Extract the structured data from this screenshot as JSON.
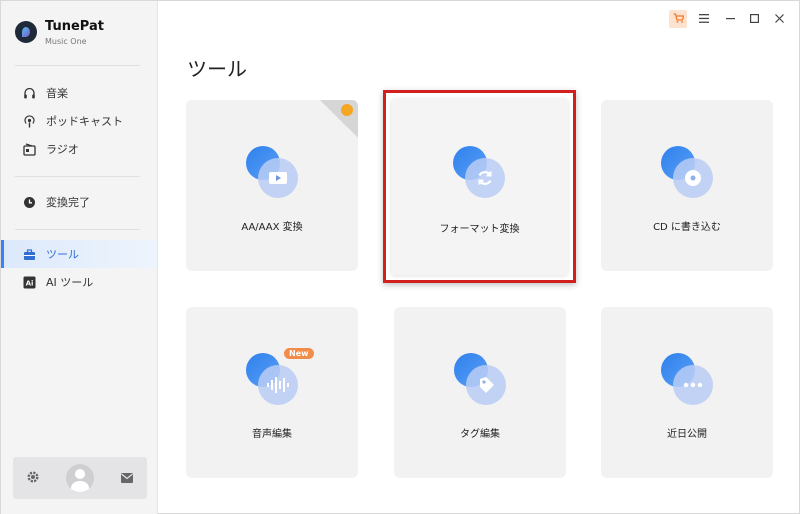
{
  "app": {
    "name": "TunePat",
    "subtitle": "Music One"
  },
  "sidebar": {
    "items": [
      {
        "label": "音楽",
        "icon": "headphones-icon"
      },
      {
        "label": "ポッドキャスト",
        "icon": "podcast-icon"
      },
      {
        "label": "ラジオ",
        "icon": "radio-icon"
      },
      {
        "label": "変換完了",
        "icon": "clock-icon"
      },
      {
        "label": "ツール",
        "icon": "toolbox-icon"
      },
      {
        "label": "AI ツール",
        "icon": "ai-icon"
      }
    ],
    "active": "ツール"
  },
  "main": {
    "title": "ツール",
    "cards": [
      {
        "label": "AA/AAX 変換",
        "icon": "video-icon",
        "corner_badge": true
      },
      {
        "label": "フォーマット変換",
        "icon": "refresh-icon",
        "highlighted": true
      },
      {
        "label": "CD に書き込む",
        "icon": "cd-icon"
      },
      {
        "label": "音声編集",
        "icon": "waveform-icon",
        "badge": "New"
      },
      {
        "label": "タグ編集",
        "icon": "tag-icon"
      },
      {
        "label": "近日公開",
        "icon": "more-icon"
      }
    ]
  },
  "colors": {
    "accent": "#3b82f6",
    "highlight_border": "#d11f1f",
    "new_badge": "#f28c4a"
  }
}
